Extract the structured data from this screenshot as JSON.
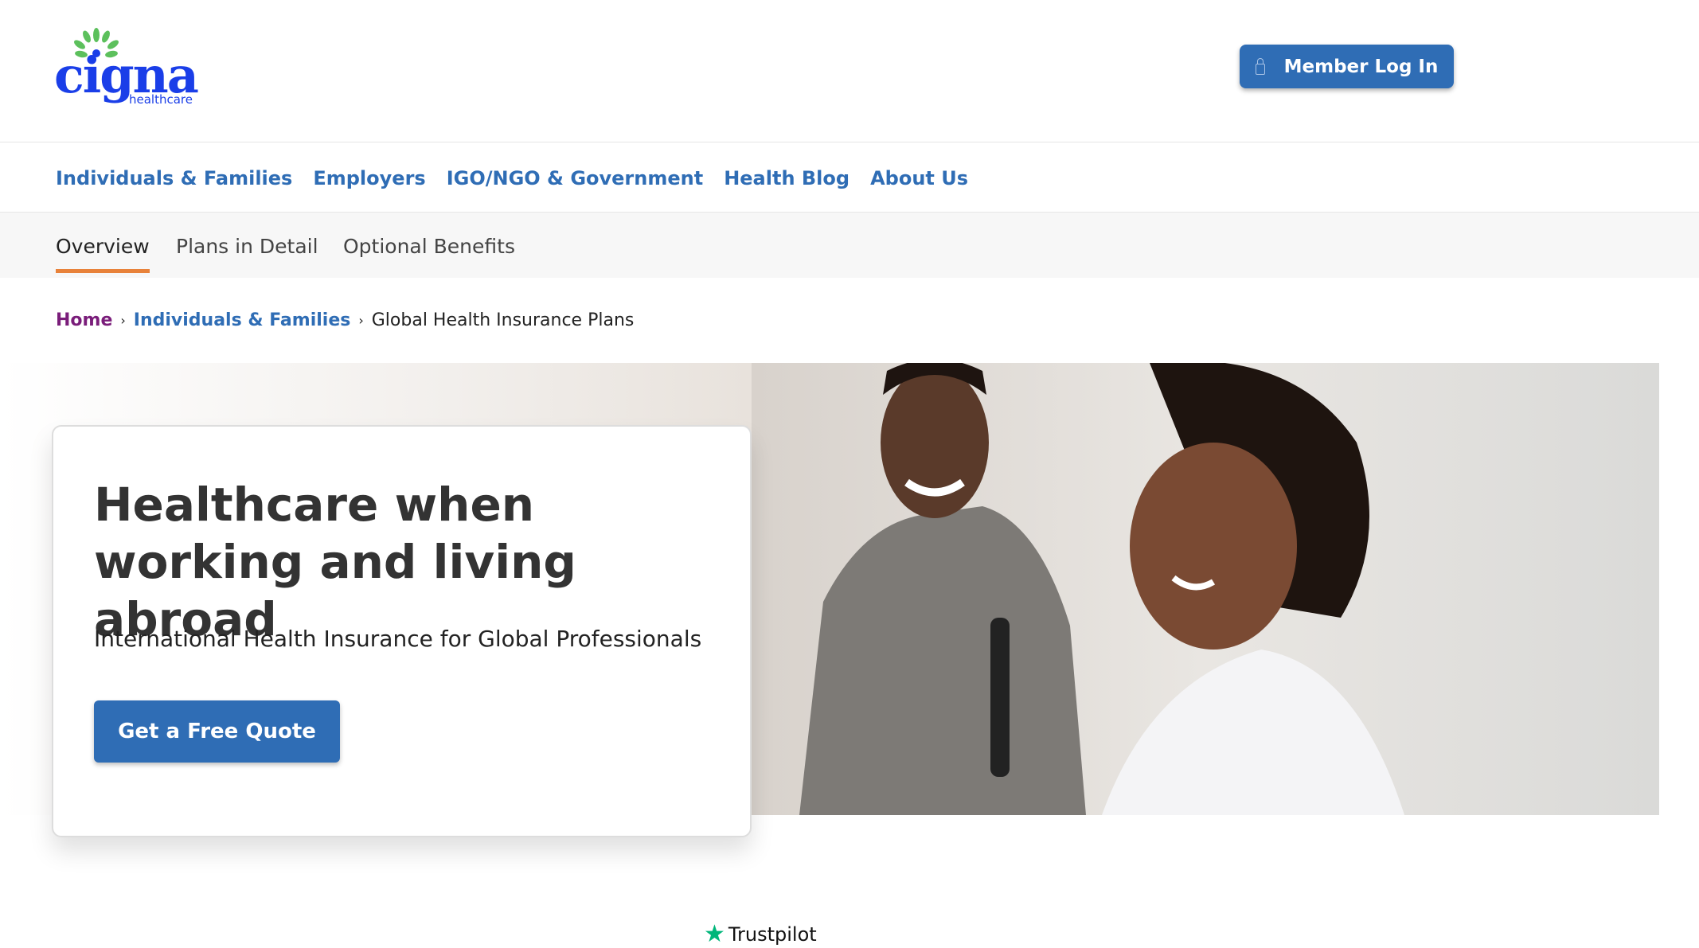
{
  "header": {
    "logo_text": "cigna",
    "logo_sub": "healthcare",
    "login_label": "Member Log In",
    "login_icon": "lock-icon"
  },
  "nav": [
    "Individuals & Families",
    "Employers",
    "IGO/NGO & Government",
    "Health Blog",
    "About Us"
  ],
  "subtabs": [
    "Overview",
    "Plans in Detail",
    "Optional Benefits"
  ],
  "breadcrumb": {
    "home": "Home",
    "parent": "Individuals & Families",
    "current": "Global Health Insurance Plans"
  },
  "hero": {
    "title": "Healthcare when working and living abroad",
    "subtitle": "International Health Insurance for Global Professionals",
    "cta": "Get a Free Quote"
  },
  "trustpilot": {
    "label": "Trustpilot",
    "color": "#00b67a"
  },
  "colors": {
    "brand_blue": "#2f6db5",
    "logo_blue": "#1a3ee8",
    "tab_accent": "#e8823a",
    "home_purple": "#7a1d7a"
  }
}
